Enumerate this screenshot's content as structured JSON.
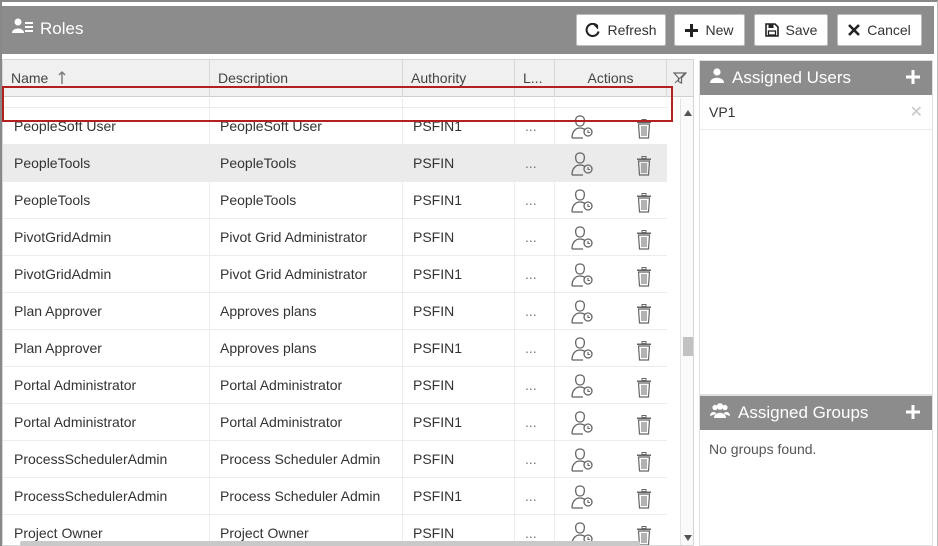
{
  "header": {
    "title": "Roles",
    "buttons": {
      "refresh": "Refresh",
      "new": "New",
      "save": "Save",
      "cancel": "Cancel"
    }
  },
  "grid": {
    "columns": {
      "name": "Name",
      "description": "Description",
      "authority": "Authority",
      "l": "L...",
      "actions": "Actions"
    },
    "sort": {
      "column": "name",
      "direction": "ascending"
    },
    "rows": [
      {
        "name": "PeopleSoft User",
        "description": "PeopleSoft User",
        "authority": "PSFIN1",
        "l": "..."
      },
      {
        "name": "PeopleTools",
        "description": "PeopleTools",
        "authority": "PSFIN",
        "l": "...",
        "selected": true
      },
      {
        "name": "PeopleTools",
        "description": "PeopleTools",
        "authority": "PSFIN1",
        "l": "..."
      },
      {
        "name": "PivotGridAdmin",
        "description": "Pivot Grid Administrator",
        "authority": "PSFIN",
        "l": "..."
      },
      {
        "name": "PivotGridAdmin",
        "description": "Pivot Grid Administrator",
        "authority": "PSFIN1",
        "l": "..."
      },
      {
        "name": "Plan Approver",
        "description": "Approves plans",
        "authority": "PSFIN",
        "l": "..."
      },
      {
        "name": "Plan Approver",
        "description": "Approves plans",
        "authority": "PSFIN1",
        "l": "..."
      },
      {
        "name": "Portal Administrator",
        "description": "Portal Administrator",
        "authority": "PSFIN",
        "l": "..."
      },
      {
        "name": "Portal Administrator",
        "description": "Portal Administrator",
        "authority": "PSFIN1",
        "l": "..."
      },
      {
        "name": "ProcessSchedulerAdmin",
        "description": "Process Scheduler Admin",
        "authority": "PSFIN",
        "l": "..."
      },
      {
        "name": "ProcessSchedulerAdmin",
        "description": "Process Scheduler Admin",
        "authority": "PSFIN1",
        "l": "..."
      },
      {
        "name": "Project Owner",
        "description": "Project Owner",
        "authority": "PSFIN",
        "l": "..."
      }
    ]
  },
  "assigned_users": {
    "title": "Assigned Users",
    "items": [
      "VP1"
    ]
  },
  "assigned_groups": {
    "title": "Assigned Groups",
    "empty_text": "No groups found."
  },
  "colors": {
    "header_bg": "#8c8c8c",
    "selection_border": "#b22020",
    "grid_header_bg": "#f0f0f0"
  }
}
